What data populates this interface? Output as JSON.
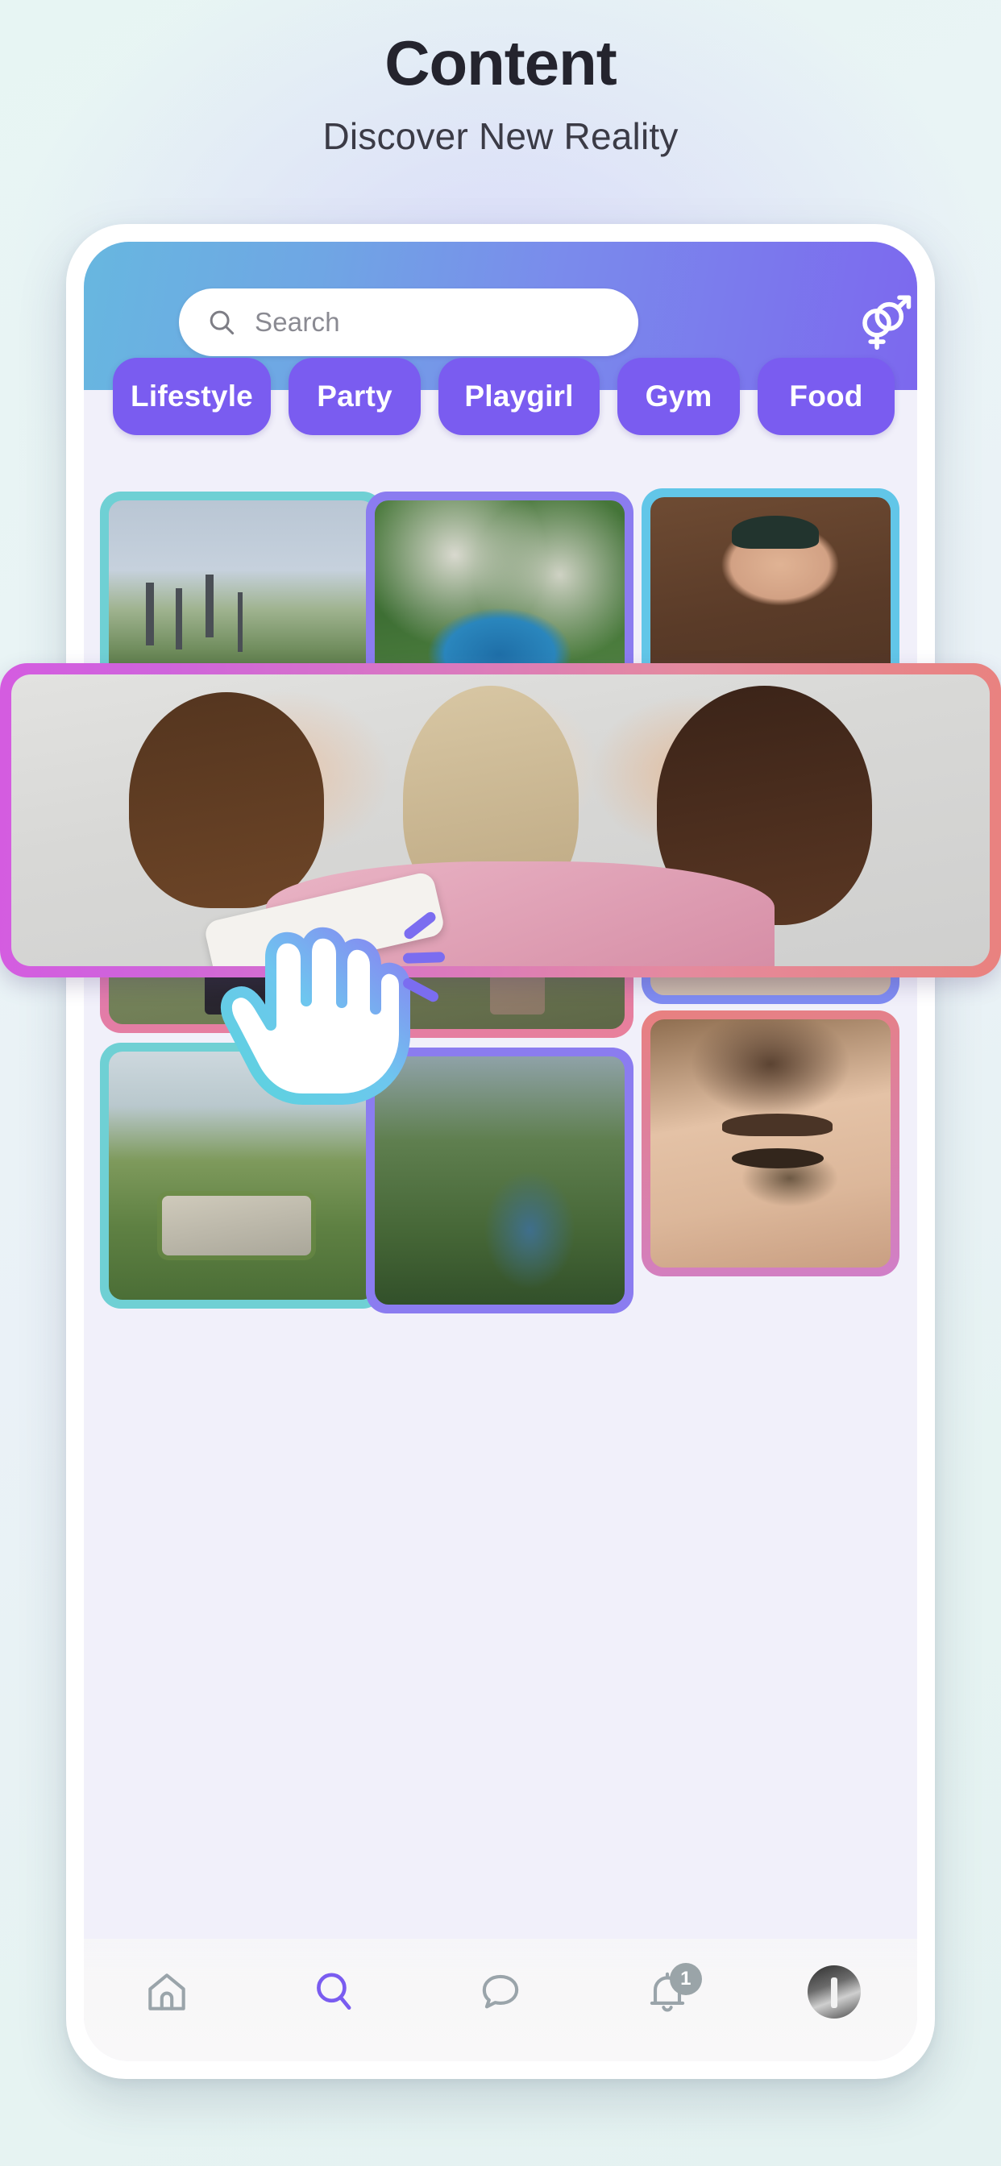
{
  "header": {
    "title": "Content",
    "subtitle": "Discover New Reality"
  },
  "colors": {
    "page_background": "#e6f3f2",
    "appbar_gradient_start": "#67b7e0",
    "appbar_gradient_end": "#7c68ee",
    "chip": "#7a5cf0",
    "active_nav": "#7a5cf0",
    "hero_border_start": "#d45ce0",
    "hero_border_end": "#e9827f",
    "title_text": "#24242e"
  },
  "app": {
    "search": {
      "placeholder": "Search",
      "value": "",
      "icon": "search-icon"
    },
    "gender_filter_icon": "gender-symbols-icon",
    "categories": [
      {
        "label": "Lifestyle",
        "selected": true
      },
      {
        "label": "Party",
        "selected": true
      },
      {
        "label": "Playgirl",
        "selected": true
      },
      {
        "label": "Gym",
        "selected": true
      },
      {
        "label": "Food",
        "selected": true
      }
    ],
    "hero_card": {
      "alt": "three women taking a selfie",
      "border_gradient": [
        "#d45ce0",
        "#e9827f"
      ]
    },
    "grid": [
      {
        "alt": "town with castle spires",
        "border": "#6fd0d4"
      },
      {
        "alt": "aerial view of lake and cliffs",
        "border": "#8b7cf0"
      },
      {
        "alt": "man holding australian shepherd puppy",
        "border": "#62c6e8"
      },
      {
        "alt": "woman in plaid coat on grassy field",
        "border": "#d06fd8"
      },
      {
        "alt": "woman walking on hillside",
        "border": "#e8809a"
      },
      {
        "alt": "couple dancing on lit street at night",
        "border": "#7f8cf2"
      },
      {
        "alt": "vineyard with green roof building",
        "border": "#6fd0d4"
      },
      {
        "alt": "green canyon with river",
        "border": "#8b7cf0"
      },
      {
        "alt": "close up of woman's eye",
        "border": "#e8807f"
      }
    ],
    "cursor": {
      "icon": "tap-hand-icon",
      "sparkles": 3
    },
    "bottom_nav": [
      {
        "name": "home",
        "icon": "home-icon",
        "active": false,
        "badge": ""
      },
      {
        "name": "search",
        "icon": "search-icon",
        "active": true,
        "badge": ""
      },
      {
        "name": "messages",
        "icon": "chat-bubble-icon",
        "active": false,
        "badge": ""
      },
      {
        "name": "notifications",
        "icon": "bell-icon",
        "active": false,
        "badge": "1"
      },
      {
        "name": "profile",
        "icon": "avatar-icon",
        "active": false,
        "badge": ""
      }
    ]
  }
}
